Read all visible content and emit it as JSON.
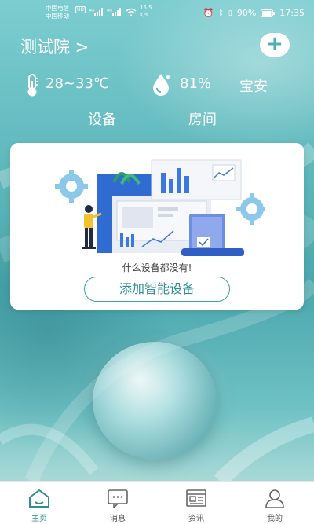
{
  "status_bar": {
    "carrier1": "中国电信",
    "carrier2": "中国移动",
    "hd": "HD",
    "net1": "⁴ᴳ",
    "net2": "⁴ᴳ",
    "speed": "15.5 K/s",
    "battery": "90%",
    "time": "17:35"
  },
  "header": {
    "home_name": "测试院 >",
    "add_label": "+"
  },
  "weather": {
    "temperature": "28~33℃",
    "humidity": "81%",
    "location": "宝安"
  },
  "tabs": [
    {
      "label": "设备"
    },
    {
      "label": "房间"
    }
  ],
  "card": {
    "empty_text": "什么设备都没有!",
    "add_button": "添加智能设备"
  },
  "bottom_nav": [
    {
      "label": "主页",
      "icon": "home-icon",
      "active": true
    },
    {
      "label": "消息",
      "icon": "message-icon",
      "active": false
    },
    {
      "label": "资讯",
      "icon": "news-icon",
      "active": false
    },
    {
      "label": "我的",
      "icon": "user-icon",
      "active": false
    }
  ],
  "colors": {
    "accent": "#3aa3a9",
    "background": "#6fc3c6",
    "nav_active": "#2f8f95"
  }
}
